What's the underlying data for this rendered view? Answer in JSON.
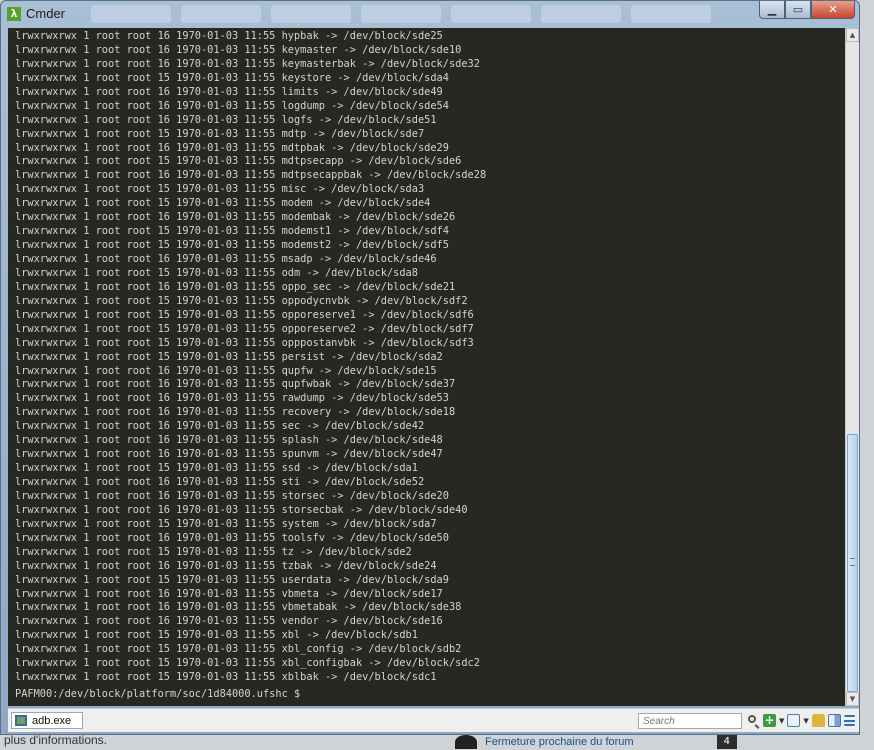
{
  "window": {
    "title": "Cmder",
    "logo": "λ"
  },
  "terminal": {
    "lines": [
      "lrwxrwxrwx 1 root root 16 1970-01-03 11:55 hypbak -> /dev/block/sde25",
      "lrwxrwxrwx 1 root root 16 1970-01-03 11:55 keymaster -> /dev/block/sde10",
      "lrwxrwxrwx 1 root root 16 1970-01-03 11:55 keymasterbak -> /dev/block/sde32",
      "lrwxrwxrwx 1 root root 15 1970-01-03 11:55 keystore -> /dev/block/sda4",
      "lrwxrwxrwx 1 root root 16 1970-01-03 11:55 limits -> /dev/block/sde49",
      "lrwxrwxrwx 1 root root 16 1970-01-03 11:55 logdump -> /dev/block/sde54",
      "lrwxrwxrwx 1 root root 16 1970-01-03 11:55 logfs -> /dev/block/sde51",
      "lrwxrwxrwx 1 root root 15 1970-01-03 11:55 mdtp -> /dev/block/sde7",
      "lrwxrwxrwx 1 root root 16 1970-01-03 11:55 mdtpbak -> /dev/block/sde29",
      "lrwxrwxrwx 1 root root 15 1970-01-03 11:55 mdtpsecapp -> /dev/block/sde6",
      "lrwxrwxrwx 1 root root 16 1970-01-03 11:55 mdtpsecappbak -> /dev/block/sde28",
      "lrwxrwxrwx 1 root root 15 1970-01-03 11:55 misc -> /dev/block/sda3",
      "lrwxrwxrwx 1 root root 15 1970-01-03 11:55 modem -> /dev/block/sde4",
      "lrwxrwxrwx 1 root root 16 1970-01-03 11:55 modembak -> /dev/block/sde26",
      "lrwxrwxrwx 1 root root 15 1970-01-03 11:55 modemst1 -> /dev/block/sdf4",
      "lrwxrwxrwx 1 root root 15 1970-01-03 11:55 modemst2 -> /dev/block/sdf5",
      "lrwxrwxrwx 1 root root 16 1970-01-03 11:55 msadp -> /dev/block/sde46",
      "lrwxrwxrwx 1 root root 15 1970-01-03 11:55 odm -> /dev/block/sda8",
      "lrwxrwxrwx 1 root root 16 1970-01-03 11:55 oppo_sec -> /dev/block/sde21",
      "lrwxrwxrwx 1 root root 15 1970-01-03 11:55 oppodycnvbk -> /dev/block/sdf2",
      "lrwxrwxrwx 1 root root 15 1970-01-03 11:55 opporeserve1 -> /dev/block/sdf6",
      "lrwxrwxrwx 1 root root 15 1970-01-03 11:55 opporeserve2 -> /dev/block/sdf7",
      "lrwxrwxrwx 1 root root 15 1970-01-03 11:55 opppostanvbk -> /dev/block/sdf3",
      "lrwxrwxrwx 1 root root 15 1970-01-03 11:55 persist -> /dev/block/sda2",
      "lrwxrwxrwx 1 root root 16 1970-01-03 11:55 qupfw -> /dev/block/sde15",
      "lrwxrwxrwx 1 root root 16 1970-01-03 11:55 qupfwbak -> /dev/block/sde37",
      "lrwxrwxrwx 1 root root 16 1970-01-03 11:55 rawdump -> /dev/block/sde53",
      "lrwxrwxrwx 1 root root 16 1970-01-03 11:55 recovery -> /dev/block/sde18",
      "lrwxrwxrwx 1 root root 16 1970-01-03 11:55 sec -> /dev/block/sde42",
      "lrwxrwxrwx 1 root root 16 1970-01-03 11:55 splash -> /dev/block/sde48",
      "lrwxrwxrwx 1 root root 16 1970-01-03 11:55 spunvm -> /dev/block/sde47",
      "lrwxrwxrwx 1 root root 15 1970-01-03 11:55 ssd -> /dev/block/sda1",
      "lrwxrwxrwx 1 root root 16 1970-01-03 11:55 sti -> /dev/block/sde52",
      "lrwxrwxrwx 1 root root 16 1970-01-03 11:55 storsec -> /dev/block/sde20",
      "lrwxrwxrwx 1 root root 16 1970-01-03 11:55 storsecbak -> /dev/block/sde40",
      "lrwxrwxrwx 1 root root 15 1970-01-03 11:55 system -> /dev/block/sda7",
      "lrwxrwxrwx 1 root root 16 1970-01-03 11:55 toolsfv -> /dev/block/sde50",
      "lrwxrwxrwx 1 root root 15 1970-01-03 11:55 tz -> /dev/block/sde2",
      "lrwxrwxrwx 1 root root 16 1970-01-03 11:55 tzbak -> /dev/block/sde24",
      "lrwxrwxrwx 1 root root 15 1970-01-03 11:55 userdata -> /dev/block/sda9",
      "lrwxrwxrwx 1 root root 16 1970-01-03 11:55 vbmeta -> /dev/block/sde17",
      "lrwxrwxrwx 1 root root 16 1970-01-03 11:55 vbmetabak -> /dev/block/sde38",
      "lrwxrwxrwx 1 root root 16 1970-01-03 11:55 vendor -> /dev/block/sde16",
      "lrwxrwxrwx 1 root root 15 1970-01-03 11:55 xbl -> /dev/block/sdb1",
      "lrwxrwxrwx 1 root root 15 1970-01-03 11:55 xbl_config -> /dev/block/sdb2",
      "lrwxrwxrwx 1 root root 15 1970-01-03 11:55 xbl_configbak -> /dev/block/sdc2",
      "lrwxrwxrwx 1 root root 15 1970-01-03 11:55 xblbak -> /dev/block/sdc1"
    ],
    "prompt": "PAFM00:/dev/block/platform/soc/1d84000.ufshc $"
  },
  "statusbar": {
    "task_label": "adb.exe",
    "search_placeholder": "Search",
    "icons": [
      "new-tab-icon",
      "console-icon",
      "lock-icon",
      "split-icon",
      "menu-icon"
    ]
  },
  "background": {
    "bottom_text": "plus d'informations.",
    "forum_link": "Fermeture prochaine du forum",
    "forum_badge": "4"
  },
  "colors": {
    "terminal_bg": "#272822",
    "terminal_fg": "#d4d4c8",
    "title_bar": "#a9bfd6",
    "close_button": "#c8452c"
  }
}
